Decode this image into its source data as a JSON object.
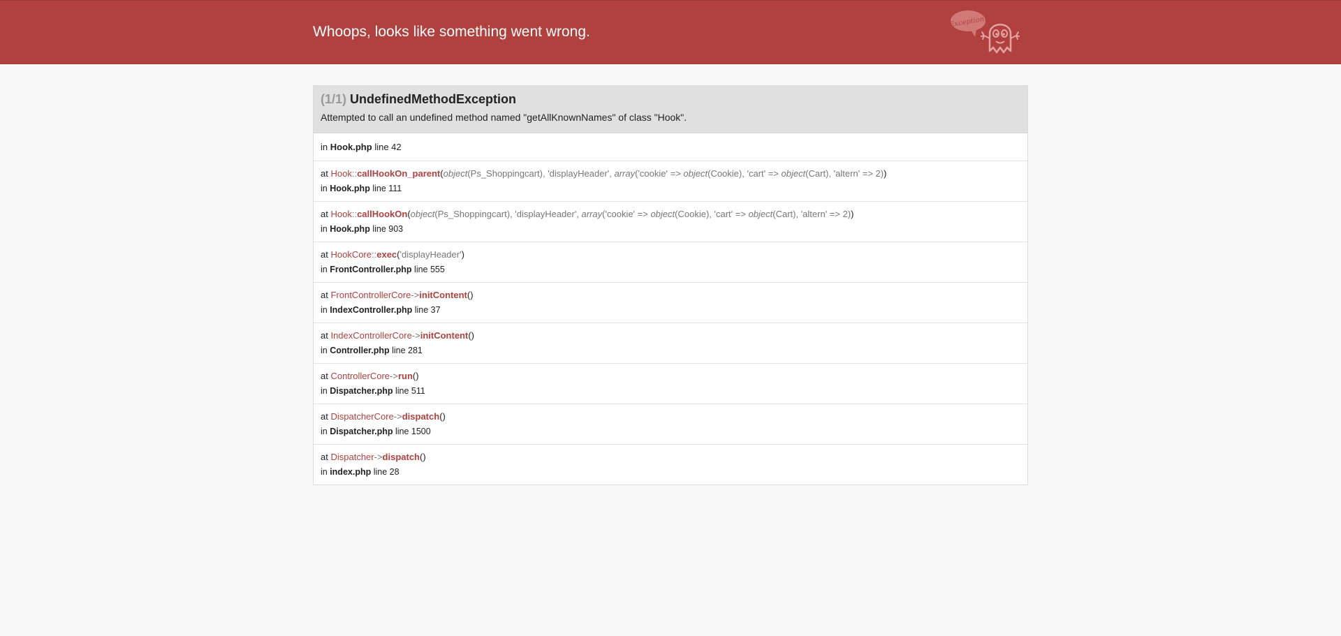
{
  "header": {
    "title": "Whoops, looks like something went wrong.",
    "logo_bubble_text": "Exception!"
  },
  "exception": {
    "count": "(1/1)",
    "name": "UndefinedMethodException",
    "message": "Attempted to call an undefined method named \"getAllKnownNames\" of class \"Hook\"."
  },
  "origin": {
    "in_word": "in",
    "file": "Hook.php",
    "line": "line 42"
  },
  "trace": [
    {
      "at_word": "at",
      "cls": "Hook",
      "sep": "::",
      "method": "callHookOn_parent",
      "args_html": [
        {
          "t": "(",
          "k": "paren"
        },
        {
          "t": "object",
          "k": "italic"
        },
        {
          "t": "(Ps_Shoppingcart), 'displayHeader', ",
          "k": "plain"
        },
        {
          "t": "array",
          "k": "italic"
        },
        {
          "t": "('cookie' => ",
          "k": "plain"
        },
        {
          "t": "object",
          "k": "italic"
        },
        {
          "t": "(Cookie), 'cart' => ",
          "k": "plain"
        },
        {
          "t": "object",
          "k": "italic"
        },
        {
          "t": "(Cart), 'altern' => 2)",
          "k": "plain"
        },
        {
          "t": ")",
          "k": "paren"
        }
      ],
      "in_word": "in",
      "file": "Hook.php",
      "line": "line 111"
    },
    {
      "at_word": "at",
      "cls": "Hook",
      "sep": "::",
      "method": "callHookOn",
      "args_html": [
        {
          "t": "(",
          "k": "paren"
        },
        {
          "t": "object",
          "k": "italic"
        },
        {
          "t": "(Ps_Shoppingcart), 'displayHeader', ",
          "k": "plain"
        },
        {
          "t": "array",
          "k": "italic"
        },
        {
          "t": "('cookie' => ",
          "k": "plain"
        },
        {
          "t": "object",
          "k": "italic"
        },
        {
          "t": "(Cookie), 'cart' => ",
          "k": "plain"
        },
        {
          "t": "object",
          "k": "italic"
        },
        {
          "t": "(Cart), 'altern' => 2)",
          "k": "plain"
        },
        {
          "t": ")",
          "k": "paren"
        }
      ],
      "in_word": "in",
      "file": "Hook.php",
      "line": "line 903"
    },
    {
      "at_word": "at",
      "cls": "HookCore",
      "sep": "::",
      "method": "exec",
      "args_html": [
        {
          "t": "(",
          "k": "paren"
        },
        {
          "t": "'displayHeader'",
          "k": "plain"
        },
        {
          "t": ")",
          "k": "paren"
        }
      ],
      "in_word": "in",
      "file": "FrontController.php",
      "line": "line 555"
    },
    {
      "at_word": "at",
      "cls": "FrontControllerCore",
      "sep": "->",
      "method": "initContent",
      "args_html": [
        {
          "t": "()",
          "k": "paren"
        }
      ],
      "in_word": "in",
      "file": "IndexController.php",
      "line": "line 37"
    },
    {
      "at_word": "at",
      "cls": "IndexControllerCore",
      "sep": "->",
      "method": "initContent",
      "args_html": [
        {
          "t": "()",
          "k": "paren"
        }
      ],
      "in_word": "in",
      "file": "Controller.php",
      "line": "line 281"
    },
    {
      "at_word": "at",
      "cls": "ControllerCore",
      "sep": "->",
      "method": "run",
      "args_html": [
        {
          "t": "()",
          "k": "paren"
        }
      ],
      "in_word": "in",
      "file": "Dispatcher.php",
      "line": "line 511"
    },
    {
      "at_word": "at",
      "cls": "DispatcherCore",
      "sep": "->",
      "method": "dispatch",
      "args_html": [
        {
          "t": "()",
          "k": "paren"
        }
      ],
      "in_word": "in",
      "file": "Dispatcher.php",
      "line": "line 1500"
    },
    {
      "at_word": "at",
      "cls": "Dispatcher",
      "sep": "->",
      "method": "dispatch",
      "args_html": [
        {
          "t": "()",
          "k": "paren"
        }
      ],
      "in_word": "in",
      "file": "index.php",
      "line": "line 28"
    }
  ],
  "colors": {
    "header_bg": "#b0413e",
    "accent": "#b0413e",
    "exception_header_bg": "#e0e0e0",
    "page_bg": "#f9f9f9"
  }
}
